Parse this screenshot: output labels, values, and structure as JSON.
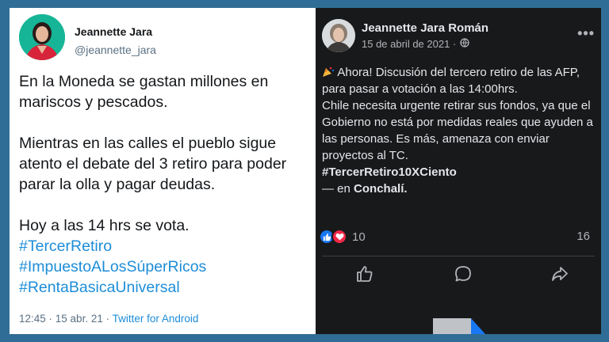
{
  "twitter": {
    "name": "Jeannette Jara",
    "handle": "@jeannette_jara",
    "text": {
      "p1": "En la Moneda se gastan millones en mariscos y pescados.",
      "p2": "Mientras en las calles el pueblo sigue atento el debate del 3 retiro para poder parar la olla y pagar deudas.",
      "p3": "Hoy a las 14 hrs se vota.",
      "hashtags": [
        "#TercerRetiro",
        "#ImpuestoALosSúperRicos",
        "#RentaBasicaUniversal"
      ]
    },
    "meta": {
      "time_date": "12:45 · 15 abr. 21 · ",
      "source": "Twitter for Android"
    }
  },
  "facebook": {
    "name": "Jeannette Jara Román",
    "date": "15 de abril de 2021 ·",
    "more": "•••",
    "text": {
      "line1": "Ahora! Discusión del tercero retiro de las AFP, para pasar a votación a las 14:00hrs.",
      "line2": "Chile necesita urgente retirar sus fondos, ya que el Gobierno no está por medidas reales que ayuden a las personas. Es más, amenaza con enviar proyectos al TC.",
      "hashtag": "#TercerRetiro10XCiento",
      "location_prefix": "— en ",
      "location": "Conchalí."
    },
    "reactions_count": "10",
    "comments_count": "16",
    "colors": {
      "background": "#18191a",
      "like": "#1877f2",
      "love": "#f02849"
    }
  },
  "colors": {
    "frame": "#2f6d96",
    "twitter_link": "#1d8dd8"
  }
}
